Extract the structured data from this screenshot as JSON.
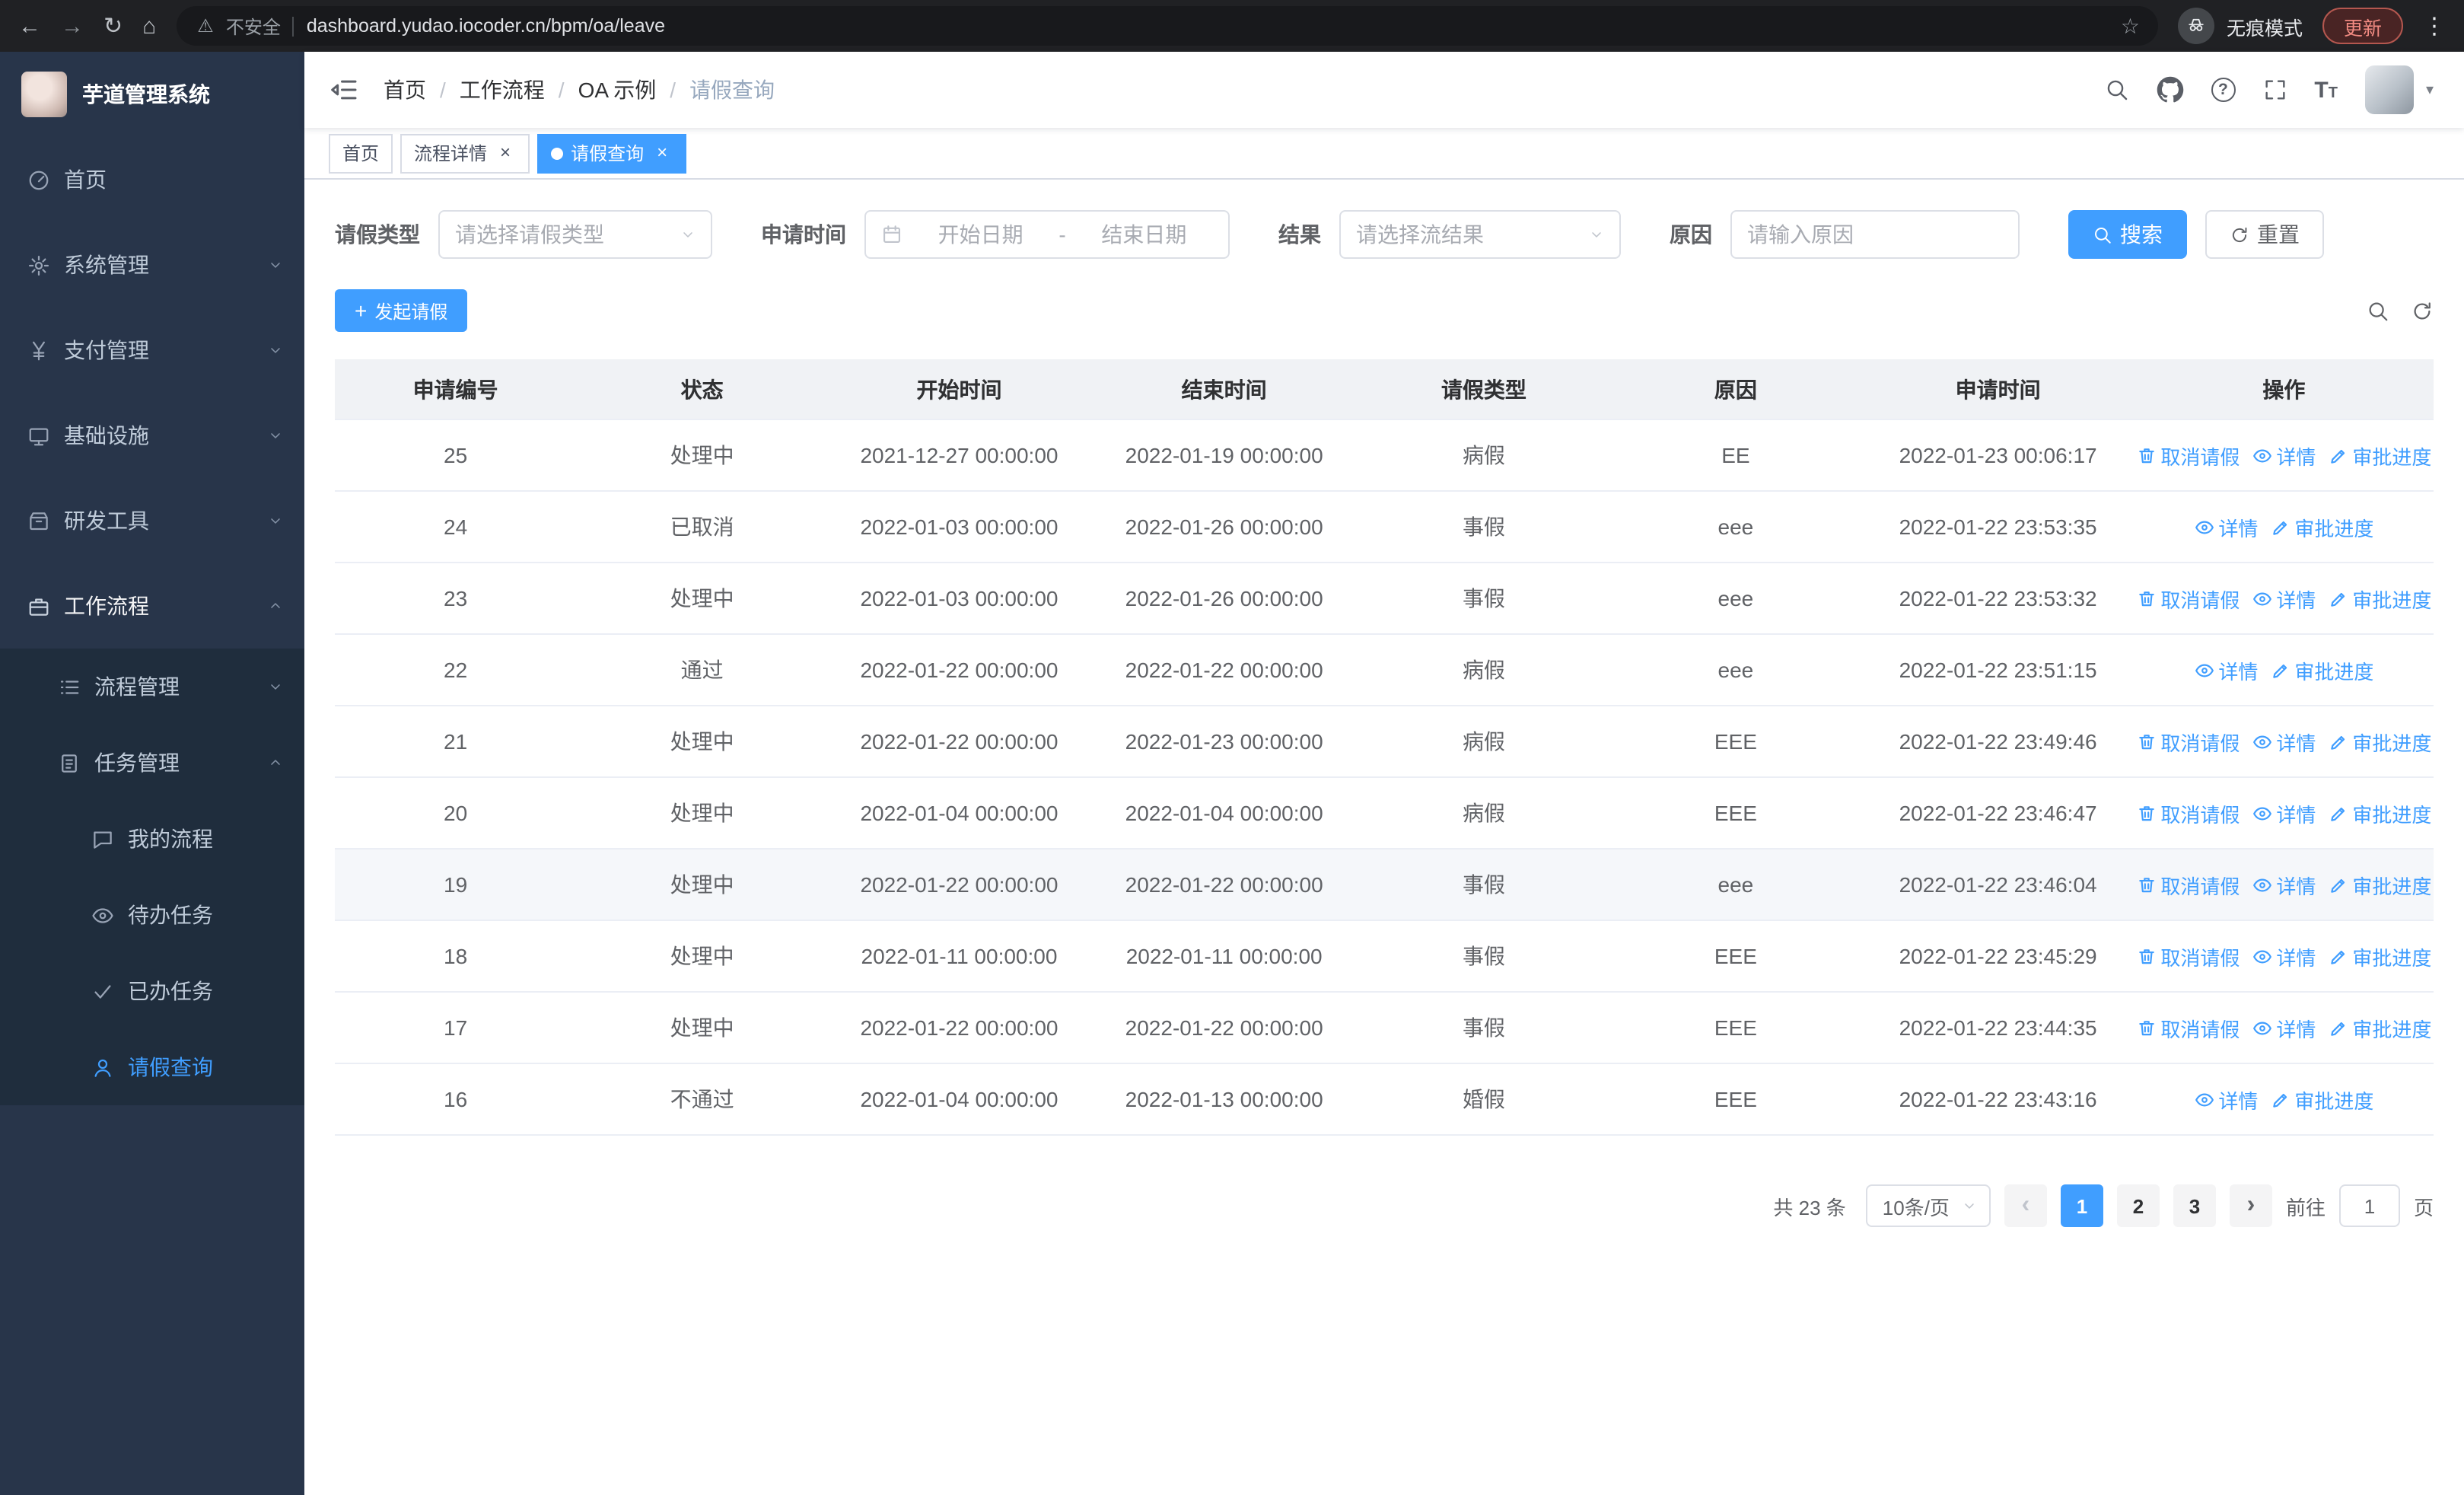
{
  "browser": {
    "security_label": "不安全",
    "url": "dashboard.yudao.iocoder.cn/bpm/oa/leave",
    "incognito_label": "无痕模式",
    "update_label": "更新"
  },
  "sidebar": {
    "logo_title": "芋道管理系统",
    "menu": [
      {
        "label": "首页",
        "icon": "dashboard-icon"
      },
      {
        "label": "系统管理",
        "icon": "gear-icon"
      },
      {
        "label": "支付管理",
        "icon": "yen-icon"
      },
      {
        "label": "基础设施",
        "icon": "monitor-icon"
      },
      {
        "label": "研发工具",
        "icon": "toolbox-icon"
      },
      {
        "label": "工作流程",
        "icon": "briefcase-icon"
      }
    ],
    "submenu": [
      {
        "label": "流程管理",
        "icon": "list-icon"
      },
      {
        "label": "任务管理",
        "icon": "clipboard-icon"
      }
    ],
    "subsubmenu": [
      {
        "label": "我的流程",
        "icon": "chat-icon"
      },
      {
        "label": "待办任务",
        "icon": "eye-icon"
      },
      {
        "label": "已办任务",
        "icon": "check-icon"
      },
      {
        "label": "请假查询",
        "icon": "user-icon"
      }
    ]
  },
  "breadcrumb": [
    "首页",
    "工作流程",
    "OA 示例",
    "请假查询"
  ],
  "tabs": [
    {
      "label": "首页"
    },
    {
      "label": "流程详情"
    },
    {
      "label": "请假查询"
    }
  ],
  "filters": {
    "leave_type_label": "请假类型",
    "leave_type_placeholder": "请选择请假类型",
    "apply_time_label": "申请时间",
    "start_placeholder": "开始日期",
    "range_separator": "-",
    "end_placeholder": "结束日期",
    "result_label": "结果",
    "result_placeholder": "请选择流结果",
    "reason_label": "原因",
    "reason_placeholder": "请输入原因",
    "search_label": "搜索",
    "reset_label": "重置"
  },
  "toolbar": {
    "create_label": "发起请假"
  },
  "table": {
    "columns": [
      "申请编号",
      "状态",
      "开始时间",
      "结束时间",
      "请假类型",
      "原因",
      "申请时间",
      "操作"
    ],
    "action_labels": {
      "cancel": "取消请假",
      "detail": "详情",
      "progress": "审批进度"
    },
    "rows": [
      {
        "id": "25",
        "status": "处理中",
        "start": "2021-12-27 00:00:00",
        "end": "2022-01-19 00:00:00",
        "type": "病假",
        "reason": "EE",
        "applied": "2022-01-23 00:06:17",
        "cancellable": true,
        "highlighted": false
      },
      {
        "id": "24",
        "status": "已取消",
        "start": "2022-01-03 00:00:00",
        "end": "2022-01-26 00:00:00",
        "type": "事假",
        "reason": "eee",
        "applied": "2022-01-22 23:53:35",
        "cancellable": false,
        "highlighted": false
      },
      {
        "id": "23",
        "status": "处理中",
        "start": "2022-01-03 00:00:00",
        "end": "2022-01-26 00:00:00",
        "type": "事假",
        "reason": "eee",
        "applied": "2022-01-22 23:53:32",
        "cancellable": true,
        "highlighted": false
      },
      {
        "id": "22",
        "status": "通过",
        "start": "2022-01-22 00:00:00",
        "end": "2022-01-22 00:00:00",
        "type": "病假",
        "reason": "eee",
        "applied": "2022-01-22 23:51:15",
        "cancellable": false,
        "highlighted": false
      },
      {
        "id": "21",
        "status": "处理中",
        "start": "2022-01-22 00:00:00",
        "end": "2022-01-23 00:00:00",
        "type": "病假",
        "reason": "EEE",
        "applied": "2022-01-22 23:49:46",
        "cancellable": true,
        "highlighted": false
      },
      {
        "id": "20",
        "status": "处理中",
        "start": "2022-01-04 00:00:00",
        "end": "2022-01-04 00:00:00",
        "type": "病假",
        "reason": "EEE",
        "applied": "2022-01-22 23:46:47",
        "cancellable": true,
        "highlighted": false
      },
      {
        "id": "19",
        "status": "处理中",
        "start": "2022-01-22 00:00:00",
        "end": "2022-01-22 00:00:00",
        "type": "事假",
        "reason": "eee",
        "applied": "2022-01-22 23:46:04",
        "cancellable": true,
        "highlighted": true
      },
      {
        "id": "18",
        "status": "处理中",
        "start": "2022-01-11 00:00:00",
        "end": "2022-01-11 00:00:00",
        "type": "事假",
        "reason": "EEE",
        "applied": "2022-01-22 23:45:29",
        "cancellable": true,
        "highlighted": false
      },
      {
        "id": "17",
        "status": "处理中",
        "start": "2022-01-22 00:00:00",
        "end": "2022-01-22 00:00:00",
        "type": "事假",
        "reason": "EEE",
        "applied": "2022-01-22 23:44:35",
        "cancellable": true,
        "highlighted": false
      },
      {
        "id": "16",
        "status": "不通过",
        "start": "2022-01-04 00:00:00",
        "end": "2022-01-13 00:00:00",
        "type": "婚假",
        "reason": "EEE",
        "applied": "2022-01-22 23:43:16",
        "cancellable": false,
        "highlighted": false
      }
    ]
  },
  "pagination": {
    "total_label": "共 23 条",
    "page_size_label": "10条/页",
    "pages": [
      "1",
      "2",
      "3"
    ],
    "active_page": "1",
    "goto_label": "前往",
    "goto_value": "1",
    "page_unit": "页"
  },
  "colors": {
    "primary": "#409eff",
    "sidebar_bg": "#28354a",
    "submenu_bg": "#1f2d3d"
  }
}
